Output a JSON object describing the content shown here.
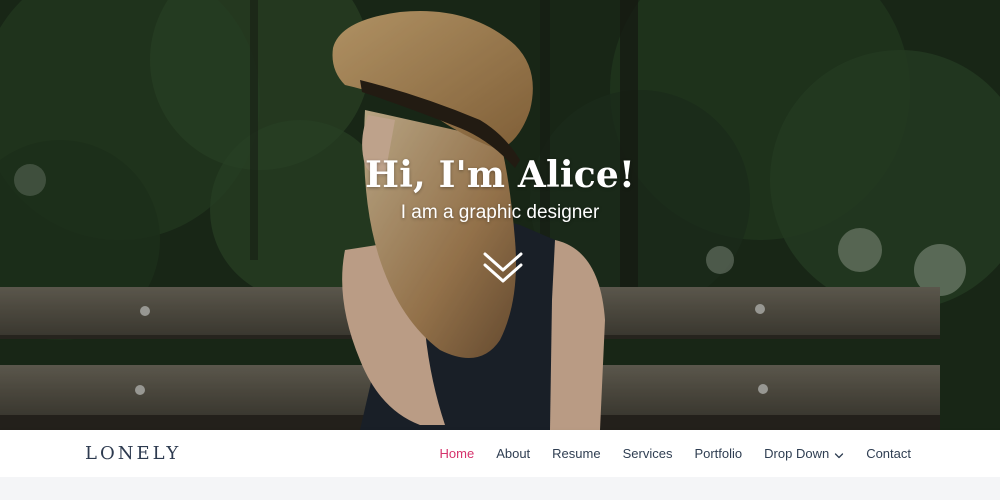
{
  "hero": {
    "title": "Hi, I'm Alice!",
    "subtitle": "I am a graphic designer",
    "scroll_icon": "chevron-double-down-icon"
  },
  "navbar": {
    "logo": "LONELY",
    "items": [
      {
        "label": "Home",
        "active": true
      },
      {
        "label": "About"
      },
      {
        "label": "Resume"
      },
      {
        "label": "Services"
      },
      {
        "label": "Portfolio"
      },
      {
        "label": "Drop Down",
        "has_dropdown": true
      },
      {
        "label": "Contact"
      }
    ]
  },
  "colors": {
    "accent": "#d6336c",
    "nav_text": "#2f3e52",
    "logo_text": "#2d3a4f",
    "navbar_bg": "#ffffff"
  }
}
